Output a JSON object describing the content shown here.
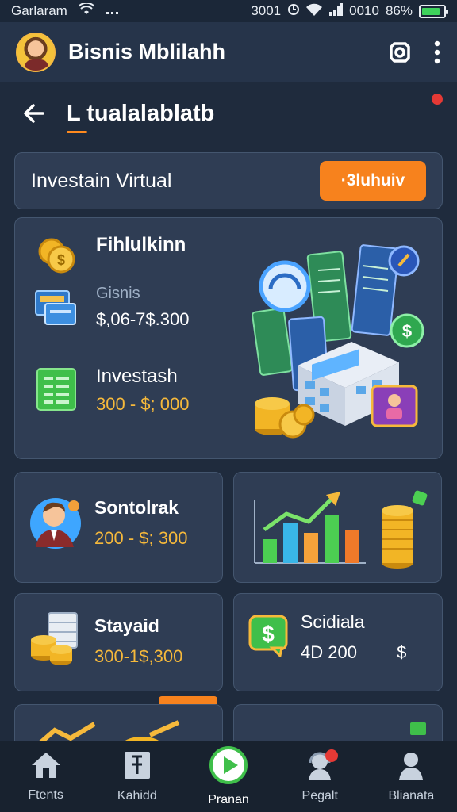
{
  "status_bar": {
    "carrier": "Garlaram",
    "time": "3001",
    "right_text": "0010",
    "battery_percent": "86%",
    "battery_level": 0.86
  },
  "header": {
    "app_title": "Bisnis Mblilahh",
    "actions": [
      "settings-icon",
      "more-vertical-icon"
    ]
  },
  "page": {
    "title": "L tualalablatb"
  },
  "invest_bar": {
    "title": "Investain Virtual",
    "button_label": "·3luhuiv"
  },
  "main_card": {
    "rows": [
      {
        "icon": "coins-icon",
        "title": "Fihlulkinn"
      },
      {
        "icon": "bill-card-icon",
        "title": "Gisnis",
        "value": "$,06-7$.300"
      },
      {
        "icon": "spreadsheet-icon",
        "title": "Investash",
        "value": "300 - $; 000"
      }
    ]
  },
  "tiles": [
    {
      "icon": "businessman-icon",
      "title": "Sontolrak",
      "value": "200 - $; 300"
    },
    {
      "icon": "growth-chart-icon"
    },
    {
      "icon": "cash-stack-icon",
      "title": "Stayaid",
      "value": "300-1$,300"
    },
    {
      "icon": "dollar-chat-icon",
      "title": "Scidiala",
      "value": "4D 200",
      "suffix": "$"
    }
  ],
  "bottom_nav": [
    {
      "label": "Ftents",
      "icon": "home-icon"
    },
    {
      "label": "Kahidd",
      "icon": "ledger-icon"
    },
    {
      "label": "Pranan",
      "icon": "play-icon"
    },
    {
      "label": "Pegalt",
      "icon": "support-agent-icon"
    },
    {
      "label": "Blianata",
      "icon": "profile-icon"
    }
  ],
  "colors": {
    "background": "#1f2b3d",
    "card": "#2f3d54",
    "accent_orange": "#f7821d",
    "gold": "#f6b93b",
    "notification_red": "#e53935"
  }
}
